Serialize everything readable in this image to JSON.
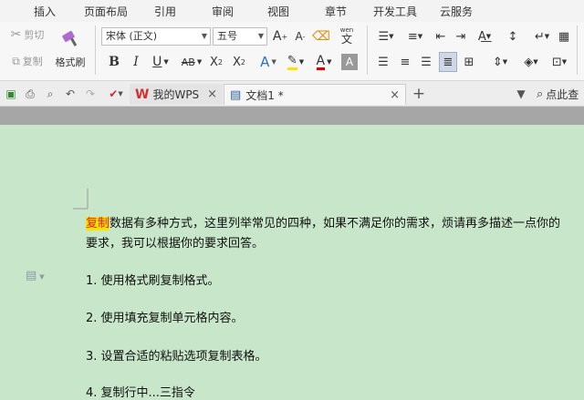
{
  "ribbon_tabs": [
    "插入",
    "页面布局",
    "引用",
    "审阅",
    "视图",
    "章节",
    "开发工具",
    "云服务"
  ],
  "clipboard": {
    "cut": "剪切",
    "copy": "复制",
    "format_painter": "格式刷"
  },
  "font": {
    "family": "宋体 (正文)",
    "size": "五号",
    "wen_glyph": "文"
  },
  "format_glyphs": {
    "bold": "B",
    "italic": "I",
    "underline": "U",
    "strike": "AB",
    "superscript": "X",
    "subscript": "X",
    "font_color_letter": "A",
    "effects_letter": "A",
    "grow": "A",
    "shrink": "A",
    "char_shade": "A"
  },
  "doc_tabs": {
    "wps": "我的WPS",
    "doc": "文档1 *",
    "new_tab": "+"
  },
  "search": {
    "label": "点此查"
  },
  "colors": {
    "wps_red": "#d32f2f",
    "highlight": "#ffe100",
    "page_bg": "#c8e6c9",
    "font_color_red": "#e00000"
  },
  "document": {
    "intro_highlight": "复制",
    "intro_rest": "数据有多种方式，这里列举常见的四种，如果不满足你的需求，烦请再多描述一点你的",
    "intro_line2": "要求，我可以根据你的要求回答。",
    "items": [
      "1. 使用格式刷复制格式。",
      "2. 使用填充复制单元格内容。",
      "3. 设置合适的粘贴选项复制表格。",
      "4. 复制行中...三指令"
    ]
  }
}
